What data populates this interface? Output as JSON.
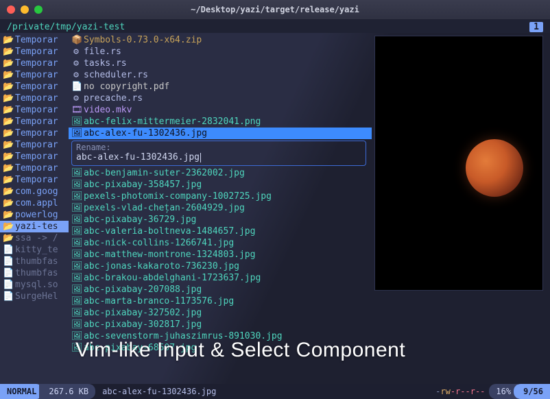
{
  "window": {
    "title": "~/Desktop/yazi/target/release/yazi"
  },
  "path": "/private/tmp/yazi-test",
  "tab_indicator": "1",
  "overlay_caption": "Vim-like Input & Select Component",
  "parent": {
    "items": [
      {
        "label": "Temporar",
        "kind": "dir"
      },
      {
        "label": "Temporar",
        "kind": "dir"
      },
      {
        "label": "Temporar",
        "kind": "dir"
      },
      {
        "label": "Temporar",
        "kind": "dir"
      },
      {
        "label": "Temporar",
        "kind": "dir"
      },
      {
        "label": "Temporar",
        "kind": "dir"
      },
      {
        "label": "Temporar",
        "kind": "dir"
      },
      {
        "label": "Temporar",
        "kind": "dir"
      },
      {
        "label": "Temporar",
        "kind": "dir"
      },
      {
        "label": "Temporar",
        "kind": "dir"
      },
      {
        "label": "Temporar",
        "kind": "dir"
      },
      {
        "label": "Temporar",
        "kind": "dir"
      },
      {
        "label": "Temporar",
        "kind": "dir"
      },
      {
        "label": "com.goog",
        "kind": "dir"
      },
      {
        "label": "com.appl",
        "kind": "dir"
      },
      {
        "label": "powerlog",
        "kind": "dir"
      },
      {
        "label": "yazi-tes",
        "kind": "dir",
        "selected": true
      },
      {
        "label": "ssa -> /",
        "kind": "link"
      },
      {
        "label": "kitty_te",
        "kind": "file"
      },
      {
        "label": "thumbfas",
        "kind": "file"
      },
      {
        "label": "thumbfas",
        "kind": "file"
      },
      {
        "label": "mysql.so",
        "kind": "file"
      },
      {
        "label": "SurgeHel",
        "kind": "file"
      }
    ]
  },
  "files": {
    "before": [
      {
        "label": "Symbols-0.73.0-x64.zip",
        "kind": "archive"
      },
      {
        "label": "file.rs",
        "kind": "code"
      },
      {
        "label": "tasks.rs",
        "kind": "code"
      },
      {
        "label": "scheduler.rs",
        "kind": "code"
      },
      {
        "label": "no copyright.pdf",
        "kind": "pdf"
      },
      {
        "label": "precache.rs",
        "kind": "code"
      },
      {
        "label": "video.mkv",
        "kind": "media"
      },
      {
        "label": "abc-felix-mittermeier-2832041.png",
        "kind": "image"
      }
    ],
    "selected": {
      "label": "abc-alex-fu-1302436.jpg",
      "kind": "image"
    },
    "rename": {
      "label": "Rename:",
      "value": "abc-alex-fu-1302436.jpg"
    },
    "after": [
      {
        "label": "abc-benjamin-suter-2362002.jpg",
        "kind": "image"
      },
      {
        "label": "abc-pixabay-358457.jpg",
        "kind": "image"
      },
      {
        "label": "pexels-photomix-company-1002725.jpg",
        "kind": "image"
      },
      {
        "label": "pexels-vlad-chețan-2604929.jpg",
        "kind": "image"
      },
      {
        "label": "abc-pixabay-36729.jpg",
        "kind": "image"
      },
      {
        "label": "abc-valeria-boltneva-1484657.jpg",
        "kind": "image"
      },
      {
        "label": "abc-nick-collins-1266741.jpg",
        "kind": "image"
      },
      {
        "label": "abc-matthew-montrone-1324803.jpg",
        "kind": "image"
      },
      {
        "label": "abc-jonas-kakaroto-736230.jpg",
        "kind": "image"
      },
      {
        "label": "abc-brakou-abdelghani-1723637.jpg",
        "kind": "image"
      },
      {
        "label": "abc-pixabay-207088.jpg",
        "kind": "image"
      },
      {
        "label": "abc-marta-branco-1173576.jpg",
        "kind": "image"
      },
      {
        "label": "abc-pixabay-327502.jpg",
        "kind": "image"
      },
      {
        "label": "abc-pixabay-302817.jpg",
        "kind": "image"
      },
      {
        "label": "abc-sevenstorm-juhaszimrus-891030.jpg",
        "kind": "image"
      },
      {
        "label": "abc-pixabay-68507.jpg",
        "kind": "image"
      }
    ]
  },
  "icons": {
    "dir": "📂",
    "link": "📂",
    "file": "📄",
    "archive": "📦",
    "code": "⚙",
    "pdf": "📄",
    "media": "🎞",
    "image": "🖼"
  },
  "status": {
    "mode": "NORMAL",
    "size": "267.6 KB",
    "filename": "abc-alex-fu-1302436.jpg",
    "perm_pre": "-",
    "perm_rw": "rw",
    "perm_mid": "-r--r--",
    "percent": "16%",
    "position": "9/56"
  }
}
